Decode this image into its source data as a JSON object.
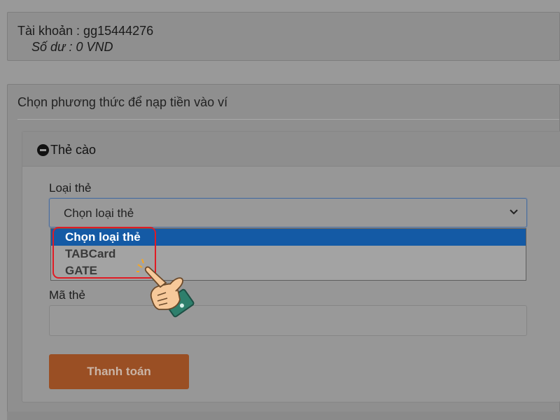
{
  "account": {
    "line1": "Tài khoản : gg15444276",
    "line2": "Số dư : 0 VND"
  },
  "method": {
    "title": "Chọn phương thức để nạp tiền vào ví"
  },
  "card": {
    "title": "Thẻ cào",
    "card_type_label": "Loại thẻ",
    "select_value": "Chọn loại thẻ",
    "options": [
      {
        "label": "Chọn loại thẻ",
        "selected": true
      },
      {
        "label": "TABCard",
        "selected": false
      },
      {
        "label": "GATE",
        "selected": false
      }
    ],
    "code_label": "Mã thẻ",
    "code_value": "",
    "pay_button": "Thanh toán"
  },
  "icons": {
    "collapse": "minus-circle-icon",
    "select_arrow": "chevron-down-icon",
    "pointer": "pointing-hand-icon"
  },
  "colors": {
    "selected_option": "#145aa5",
    "highlight": "#e01b24",
    "pay_button": "#9a4f24"
  }
}
